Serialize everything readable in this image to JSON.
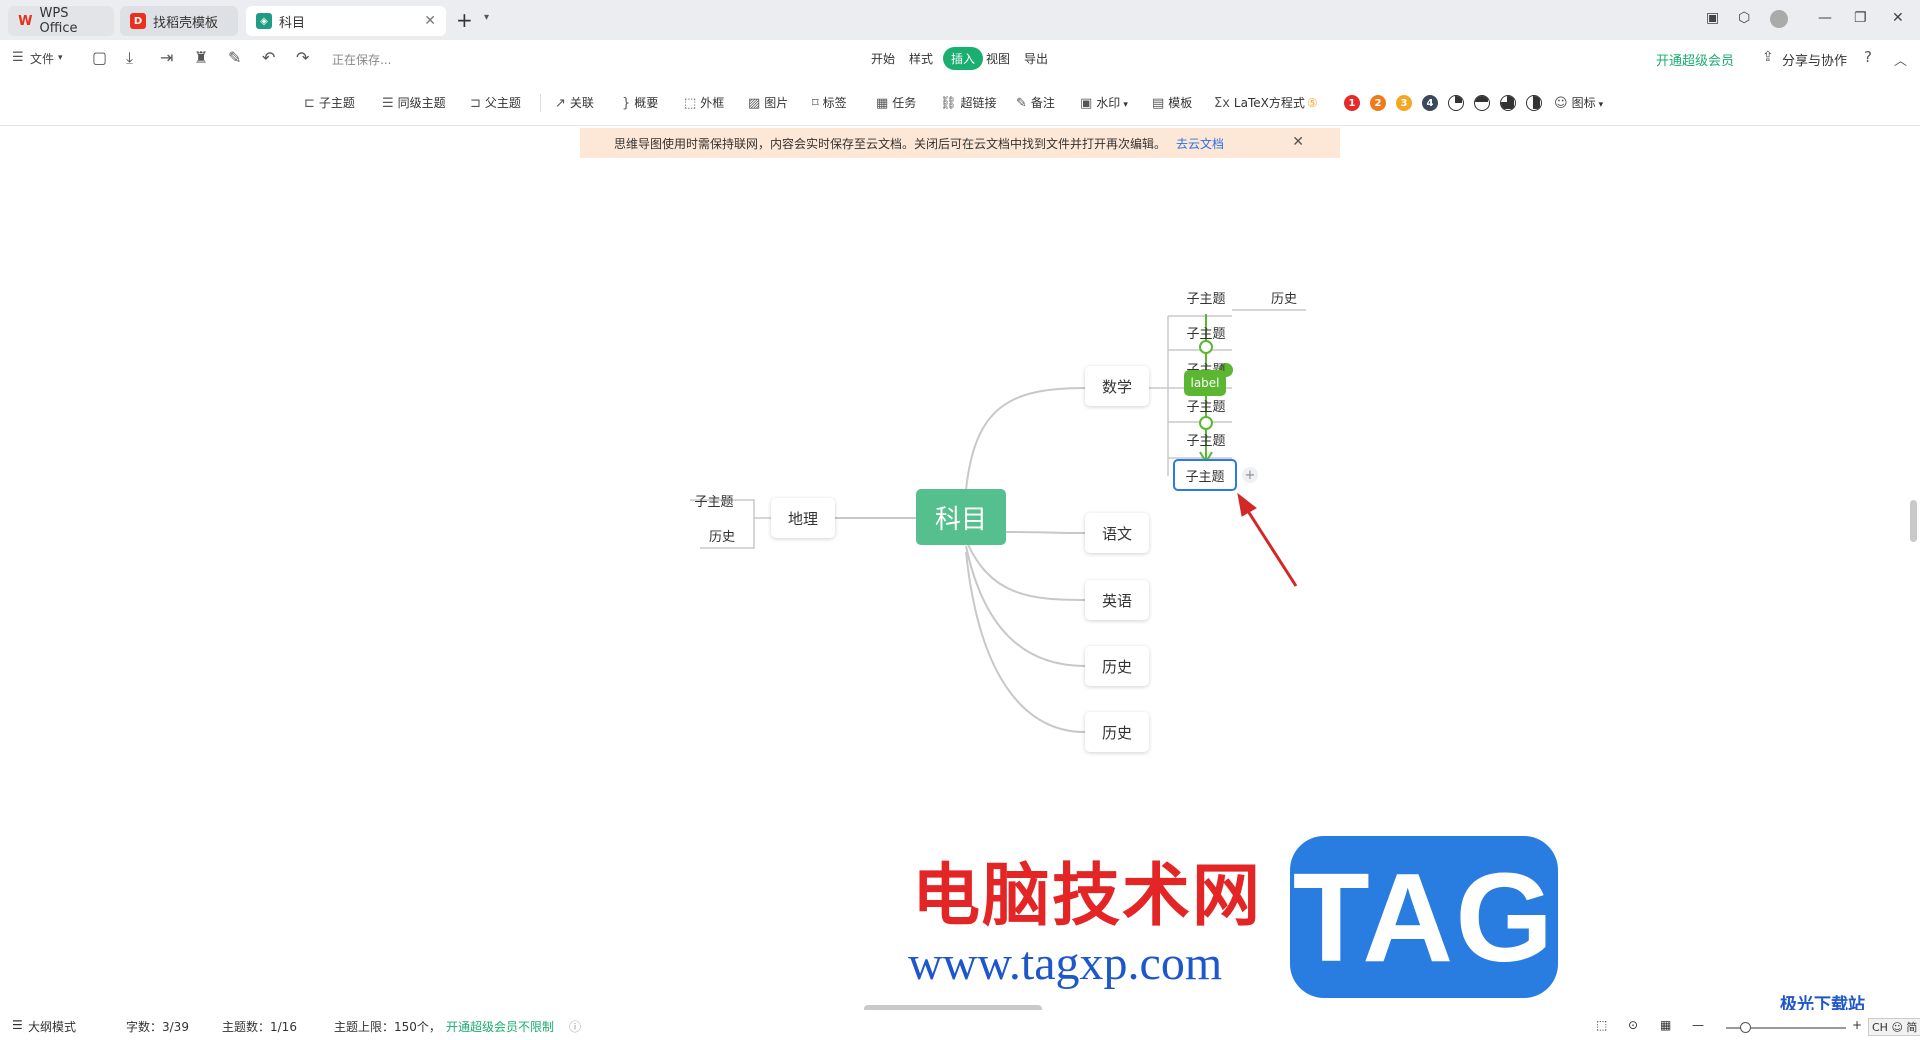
{
  "tabs": {
    "wps": "WPS Office",
    "templates": "找稻壳模板",
    "doc": "科目"
  },
  "menubar": {
    "file": "文件",
    "saving": "正在保存...",
    "tabs": [
      "开始",
      "样式",
      "插入",
      "视图",
      "导出"
    ],
    "active_tab": "插入",
    "vip": "开通超级会员",
    "share": "分享与协作"
  },
  "toolbar": {
    "child_topic": "子主题",
    "sibling_topic": "同级主题",
    "parent_topic": "父主题",
    "relation": "关联",
    "summary": "概要",
    "frame": "外框",
    "image": "图片",
    "tag": "标签",
    "task": "任务",
    "hyperlink": "超链接",
    "note": "备注",
    "watermark": "水印",
    "template": "模板",
    "latex": "LaTeX方程式",
    "icon": "图标",
    "priorities": [
      "1",
      "2",
      "3",
      "4"
    ],
    "priority_colors": [
      "#e52a2a",
      "#f07a1a",
      "#f5a623",
      "#3a4a5c"
    ]
  },
  "notice": {
    "text": "思维导图使用时需保持联网，内容会实时保存至云文档。关闭后可在云文档中找到文件并打开再次编辑。",
    "link": "去云文档"
  },
  "mindmap": {
    "root": "科目",
    "branches": {
      "math": "数学",
      "chinese": "语文",
      "english": "英语",
      "history1": "历史",
      "history2": "历史",
      "geography": "地理"
    },
    "math_children": [
      "子主题",
      "子主题",
      "子主题",
      "子主题",
      "子主题"
    ],
    "math_extra": "历史",
    "selected": "子主题",
    "relation_label": "label",
    "geo_children": [
      "子主题",
      "历史"
    ]
  },
  "watermark": {
    "line1": "电脑技术网",
    "line2": "www.tagxp.com",
    "tag": "TAG",
    "corner": "极光下载站"
  },
  "statusbar": {
    "outline": "大纲模式",
    "words": "字数：3/39",
    "topics": "主题数：1/16",
    "limit": "主题上限：150个，",
    "limit_link": "开通超级会员不限制",
    "lang": "CH ☺ 简"
  }
}
